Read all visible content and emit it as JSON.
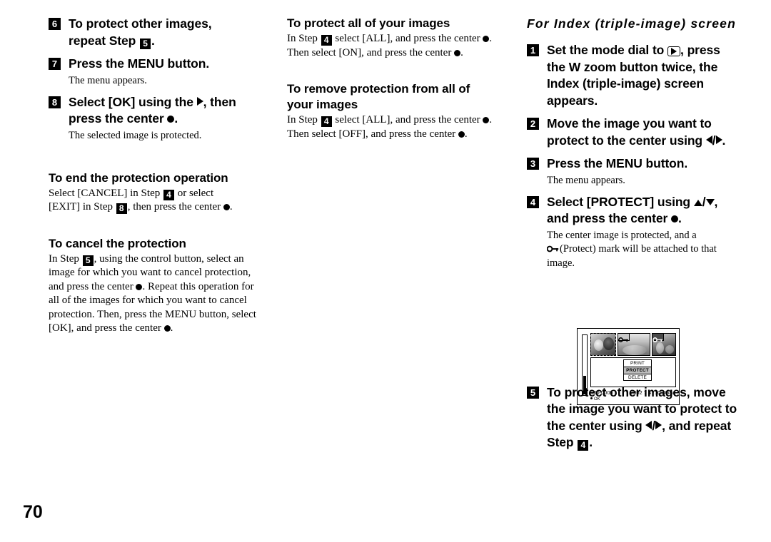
{
  "page": {
    "number": "70"
  },
  "column1": {
    "steps": [
      {
        "num": "6",
        "title_a": "To protect other images,",
        "title_b": "repeat Step",
        "ref": "5",
        "title_c": "."
      },
      {
        "num": "7",
        "title_a": "Press the MENU button.",
        "note": "The menu appears."
      },
      {
        "num": "8",
        "title_a": "Select [OK] using the",
        "icon": "triangle-right-icon",
        "title_b": ", then",
        "title_c": "press the center",
        "icon2": "circle-dot-icon",
        "title_d": ".",
        "note": "The selected image is protected."
      }
    ],
    "sections": [
      {
        "heading": "To end the protection operation",
        "body_a": "Select [CANCEL] in Step",
        "ref1": "4",
        "body_b": "or select",
        "body_c": "[EXIT] in Step",
        "ref2": "8",
        "body_d": ", then press the center",
        "body_e": "."
      },
      {
        "heading": "To cancel the protection",
        "body_a": "In Step",
        "ref1": "5",
        "body_b": ", using the control button, select an image for which you want to cancel protection, and press the center",
        "body_c": ". Repeat this operation for all of the images for which you want to cancel protection. Then, press the MENU button, select [OK], and press the center",
        "body_d": "."
      }
    ]
  },
  "column2": {
    "sections": [
      {
        "heading": "To protect all of your images",
        "body_a": "In Step",
        "ref1": "4",
        "body_b": "select [ALL], and press the center",
        "body_c": ". Then select [ON], and press the center",
        "body_d": "."
      },
      {
        "heading": "To remove protection from all of your images",
        "body_a": "In Step",
        "ref1": "4",
        "body_b": "select [ALL], and press the center",
        "body_c": ". Then select [OFF], and press the center",
        "body_d": "."
      }
    ]
  },
  "column3": {
    "heading": "For Index (triple-image) screen",
    "steps": [
      {
        "num": "1",
        "title_a": "Set the mode dial to",
        "icon": "mode-dial-playback-icon",
        "title_b": ", press the W zoom button twice, the Index (triple-image) screen appears."
      },
      {
        "num": "2",
        "title_a": "Move the image you want to protect to the center using",
        "icon_l": "triangle-left-icon",
        "sep": "/",
        "icon_r": "triangle-right-icon",
        "title_b": "."
      },
      {
        "num": "3",
        "title_a": "Press the MENU button.",
        "note": "The menu appears."
      },
      {
        "num": "4",
        "title_a": "Select [PROTECT] using",
        "icon_u": "triangle-up-icon",
        "sep": "/",
        "icon_d": "triangle-down-icon",
        "title_b": ",",
        "title_c": "and press the center",
        "icon2": "circle-dot-icon",
        "title_d": ".",
        "note_a": "The center image is protected, and a",
        "note_icon": "protect-key-icon",
        "note_b": "(Protect) mark will be attached to that image."
      },
      {
        "num": "5",
        "title_a": "To protect other images, move the image you want to protect to the center using",
        "icon_l": "triangle-left-icon",
        "sep": "/",
        "icon_r": "triangle-right-icon",
        "title_b": ", and repeat Step",
        "ref": "4",
        "title_c": "."
      }
    ],
    "lcd": {
      "menu": [
        {
          "label": "PRINT",
          "selected": false
        },
        {
          "label": "PROTECT",
          "selected": true
        },
        {
          "label": "DELETE",
          "selected": false
        }
      ],
      "file_number": "100-0005",
      "date": "2002 7 4",
      "time": "10:30",
      "ampm": "PM",
      "ok_label": "OK",
      "protect_badge_icon": "protect-key-icon"
    }
  }
}
